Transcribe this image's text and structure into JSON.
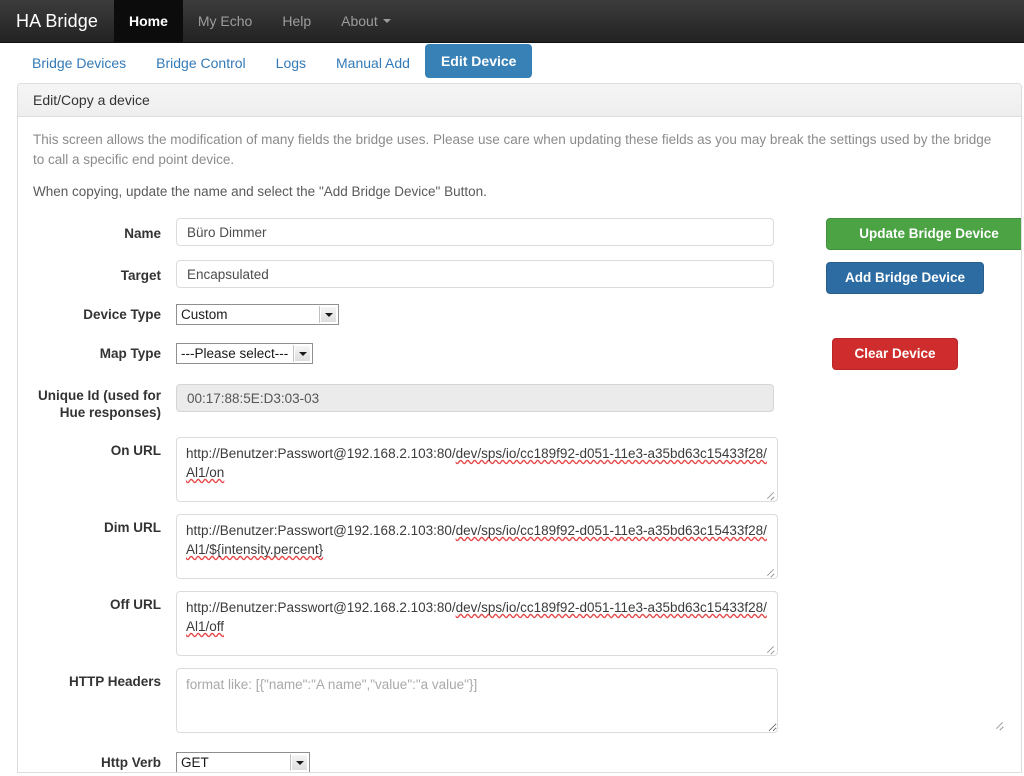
{
  "navbar": {
    "brand": "HA Bridge",
    "items": [
      {
        "label": "Home",
        "active": true,
        "caret": false
      },
      {
        "label": "My Echo",
        "active": false,
        "caret": false
      },
      {
        "label": "Help",
        "active": false,
        "caret": false
      },
      {
        "label": "About",
        "active": false,
        "caret": true
      }
    ]
  },
  "tabs": [
    {
      "label": "Bridge Devices",
      "active": false
    },
    {
      "label": "Bridge Control",
      "active": false
    },
    {
      "label": "Logs",
      "active": false
    },
    {
      "label": "Manual Add",
      "active": false
    },
    {
      "label": "Edit Device",
      "active": true
    }
  ],
  "panel": {
    "heading": "Edit/Copy a device",
    "intro_1": "This screen allows the modification of many fields the bridge uses. Please use care when updating these fields as you may break the settings used by the bridge to call a specific end point device.",
    "intro_2": "When copying, update the name and select the \"Add Bridge Device\" Button."
  },
  "form": {
    "name": {
      "label": "Name",
      "value": "Büro Dimmer",
      "placeholder": ""
    },
    "target": {
      "label": "Target",
      "value": "Encapsulated",
      "placeholder": ""
    },
    "device_type": {
      "label": "Device Type",
      "value": "Custom",
      "options": [
        "Custom"
      ]
    },
    "map_type": {
      "label": "Map Type",
      "value": "---Please select---",
      "options": [
        "---Please select---"
      ]
    },
    "unique_id": {
      "label": "Unique Id (used for Hue responses)",
      "value": "00:17:88:5E:D3:03-03",
      "readonly": true
    },
    "on_url": {
      "label": "On URL",
      "prefix": "http://Benutzer:Passwort@192.168.2.103:80/",
      "spelled": "dev/sps/io/cc189f92-d051-11e3-a35bd63c15433f28/Al1/on",
      "value": "http://Benutzer:Passwort@192.168.2.103:80/dev/sps/io/cc189f92-d051-11e3-a35bd63c15433f28/Al1/on"
    },
    "dim_url": {
      "label": "Dim URL",
      "prefix": "http://Benutzer:Passwort@192.168.2.103:80/",
      "spelled": "dev/sps/io/cc189f92-d051-11e3-a35bd63c15433f28/Al1/${intensity.percent}",
      "value": "http://Benutzer:Passwort@192.168.2.103:80/dev/sps/io/cc189f92-d051-11e3-a35bd63c15433f28/Al1/${intensity.percent}"
    },
    "off_url": {
      "label": "Off URL",
      "prefix": "http://Benutzer:Passwort@192.168.2.103:80/",
      "spelled": "dev/sps/io/cc189f92-d051-11e3-a35bd63c15433f28/Al1/off",
      "value": "http://Benutzer:Passwort@192.168.2.103:80/dev/sps/io/cc189f92-d051-11e3-a35bd63c15433f28/Al1/off"
    },
    "http_headers": {
      "label": "HTTP Headers",
      "value": "",
      "placeholder": "format like: [{\"name\":\"A name\",\"value\":\"a value\"}]"
    },
    "http_verb": {
      "label": "Http Verb",
      "value": "GET",
      "options": [
        "GET"
      ]
    }
  },
  "buttons": {
    "update": "Update Bridge Device",
    "add": "Add Bridge Device",
    "clear": "Clear Device"
  },
  "colors": {
    "navbar_bg": "#2b2b2b",
    "tab_active_bg": "#3881b7",
    "link": "#337ab7",
    "green": "#4ba344",
    "blue": "#2d6ca2",
    "red": "#cf2d2d",
    "spellcheck_underline": "#e84747"
  }
}
